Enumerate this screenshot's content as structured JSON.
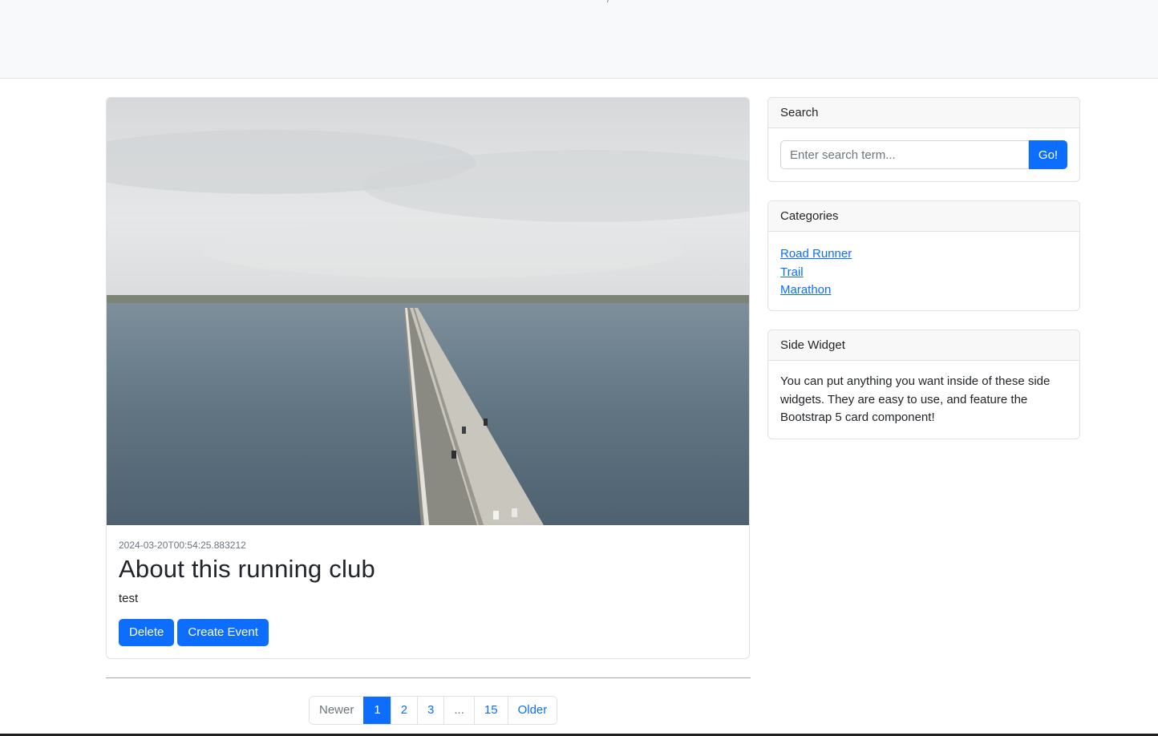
{
  "header": {
    "fragment": "/"
  },
  "post": {
    "image_alt": "Aerial view of a long bridge crossing the sea",
    "date": "2024-03-20T00:54:25.883212",
    "title": "About this running club",
    "body": "test",
    "delete_label": "Delete",
    "create_event_label": "Create Event"
  },
  "pagination": {
    "newer": "Newer",
    "pages": [
      "1",
      "2",
      "3",
      "...",
      "15"
    ],
    "active": "1",
    "older": "Older"
  },
  "search": {
    "header": "Search",
    "placeholder": "Enter search term...",
    "button": "Go!"
  },
  "categories": {
    "header": "Categories",
    "items": [
      "Road Runner",
      "Trail",
      "Marathon"
    ]
  },
  "side_widget": {
    "header": "Side Widget",
    "text": "You can put anything you want inside of these side widgets. They are easy to use, and feature the Bootstrap 5 card component!"
  },
  "colors": {
    "primary": "#0d6efd",
    "navbar_bg": "#f8f9fa",
    "border": "#dee2e6"
  }
}
